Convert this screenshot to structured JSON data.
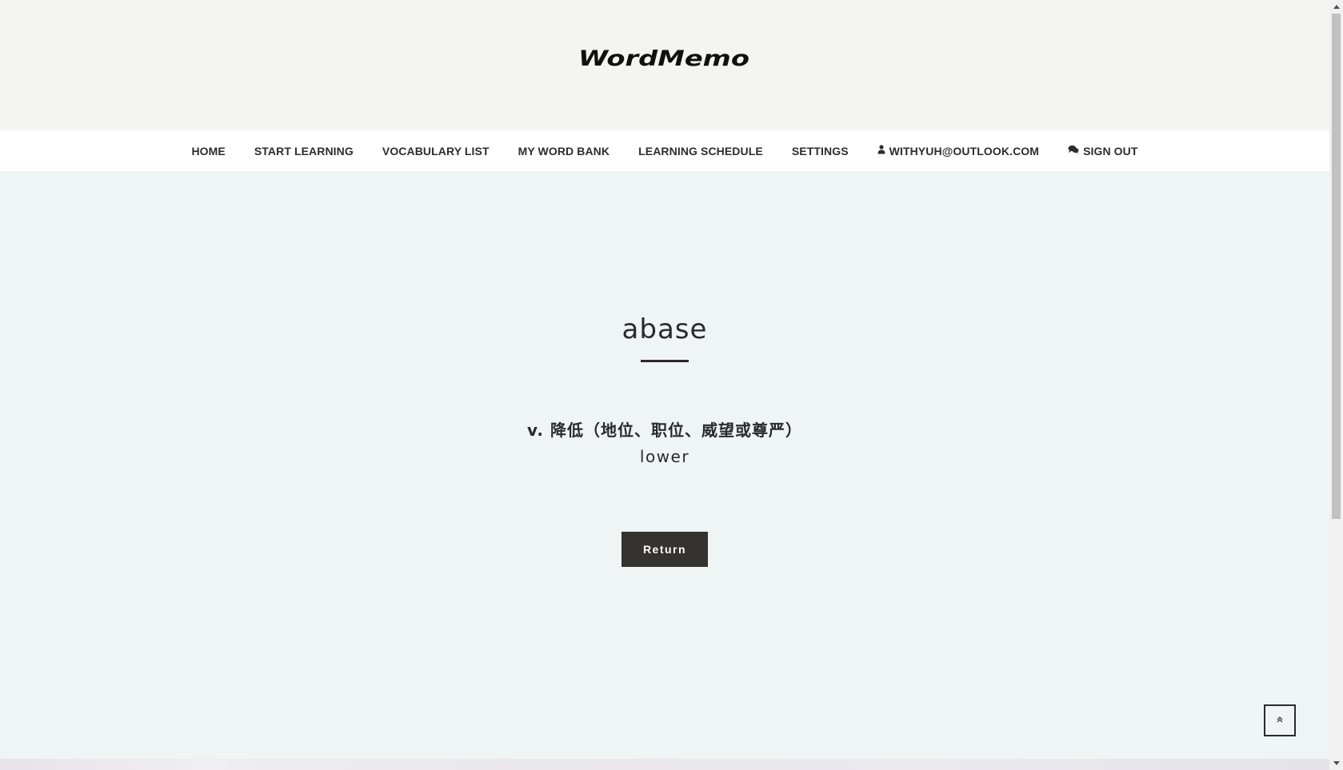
{
  "app": {
    "logo_text": "WordMemo"
  },
  "nav": {
    "items": [
      {
        "label": "HOME",
        "icon": null
      },
      {
        "label": "START LEARNING",
        "icon": null
      },
      {
        "label": "VOCABULARY LIST",
        "icon": null
      },
      {
        "label": "MY WORD BANK",
        "icon": null
      },
      {
        "label": "LEARNING SCHEDULE",
        "icon": null
      },
      {
        "label": "SETTINGS",
        "icon": null
      },
      {
        "label": "WITHYUH@OUTLOOK.COM",
        "icon": "user-icon"
      },
      {
        "label": "SIGN OUT",
        "icon": "comments-icon"
      }
    ]
  },
  "word": {
    "term": "abase",
    "definition": "v. 降低（地位、职位、威望或尊严）",
    "synonym": "lower"
  },
  "actions": {
    "return_label": "Return"
  },
  "back_to_top": {
    "icon": "double-chevron-up-icon"
  },
  "colors": {
    "header_bg": "#f4f4f2",
    "nav_bg": "#ffffff",
    "main_bg": "#eff4f4",
    "button_bg": "#35332f",
    "text": "#2a2a2a"
  }
}
